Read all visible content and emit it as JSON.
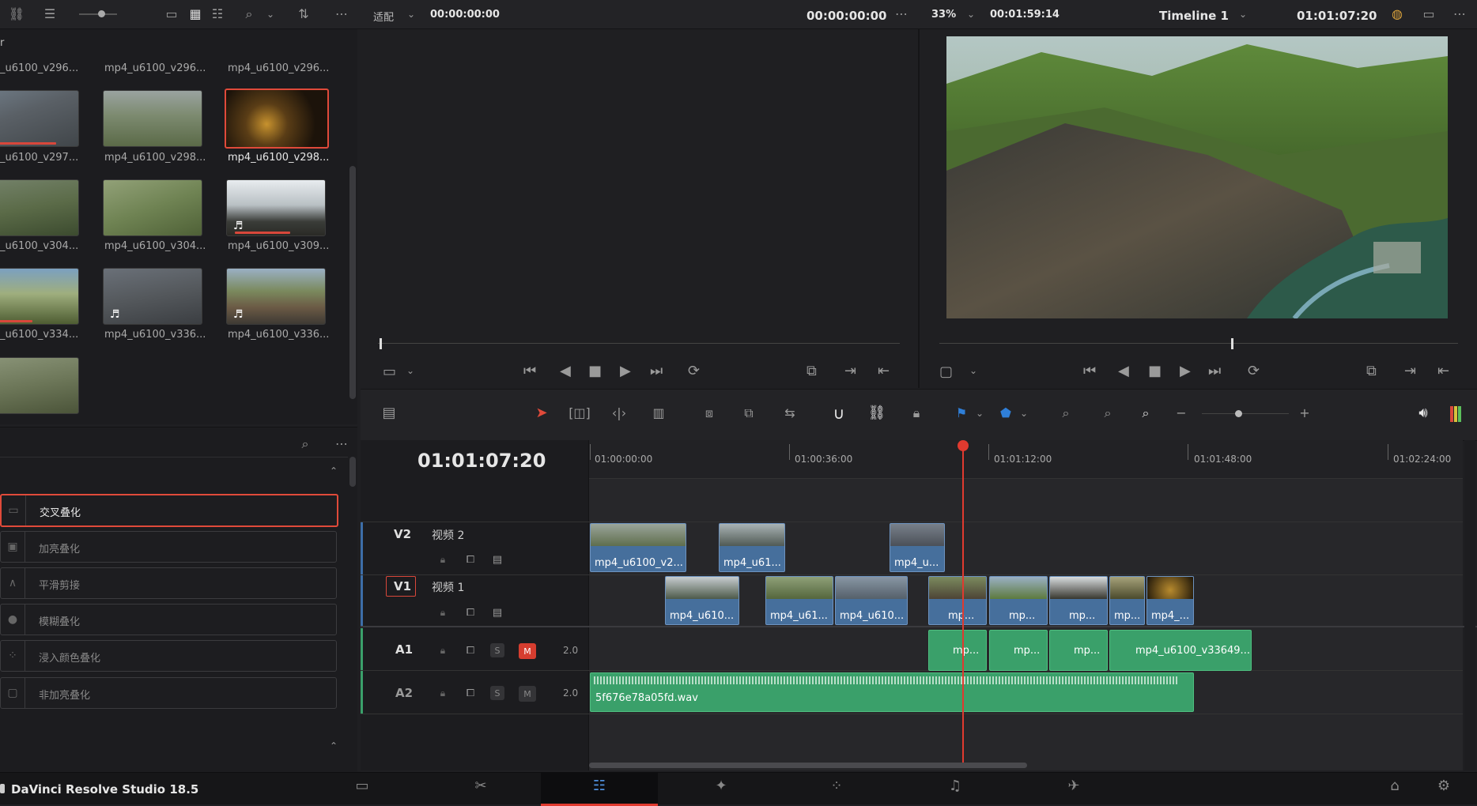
{
  "top_bar": {
    "fit_label": "适配",
    "source_timecode": "00:00:00:00",
    "source_duration": "00:00:00:00",
    "zoom": "33%",
    "timeline_duration": "00:01:59:14",
    "timeline_name": "Timeline 1",
    "timeline_timecode": "01:01:07:20"
  },
  "media_pool": {
    "header_truncated": "r",
    "top_row_labels": [
      "_u6100_v296...",
      "mp4_u6100_v296...",
      "mp4_u6100_v296..."
    ],
    "clips": [
      {
        "label": "_u6100_v297...",
        "audio": false,
        "selected": false,
        "redline": true
      },
      {
        "label": "mp4_u6100_v298...",
        "audio": false,
        "selected": false,
        "redline": false
      },
      {
        "label": "mp4_u6100_v298...",
        "audio": false,
        "selected": true,
        "redline": false
      },
      {
        "label": "_u6100_v304...",
        "audio": false,
        "selected": false,
        "redline": false
      },
      {
        "label": "mp4_u6100_v304...",
        "audio": false,
        "selected": false,
        "redline": false
      },
      {
        "label": "mp4_u6100_v309...",
        "audio": true,
        "selected": false,
        "redline": true
      },
      {
        "label": "_u6100_v334...",
        "audio": false,
        "selected": false,
        "redline": true
      },
      {
        "label": "mp4_u6100_v336...",
        "audio": true,
        "selected": false,
        "redline": false
      },
      {
        "label": "mp4_u6100_v336...",
        "audio": true,
        "selected": false,
        "redline": false
      }
    ]
  },
  "transitions": {
    "items": [
      "交叉叠化",
      "加亮叠化",
      "平滑剪接",
      "模糊叠化",
      "浸入颜色叠化",
      "非加亮叠化"
    ],
    "selected_index": 0
  },
  "timeline": {
    "current_timecode": "01:01:07:20",
    "ruler": [
      "01:00:00:00",
      "01:00:36:00",
      "01:01:12:00",
      "01:01:48:00",
      "01:02:24:00"
    ],
    "tracks": {
      "v2": {
        "id": "V2",
        "name": "视频 2"
      },
      "v1": {
        "id": "V1",
        "name": "视频 1"
      },
      "a1": {
        "id": "A1",
        "s": "S",
        "m": "M",
        "channels": "2.0"
      },
      "a2": {
        "id": "A2",
        "s": "S",
        "m": "M",
        "channels": "2.0"
      }
    },
    "v2_clips": [
      "mp4_u6100_v2...",
      "mp4_u61...",
      "mp4_u..."
    ],
    "v1_clips": [
      "mp4_u610...",
      "mp4_u61...",
      "mp4_u610...",
      "mp...",
      "mp...",
      "mp...",
      "mp...",
      "mp4_..."
    ],
    "a1_clips": [
      "mp...",
      "mp...",
      "mp...",
      "mp4_u6100_v33649..."
    ],
    "a2_clip": "5f676e78a05fd.wav"
  },
  "footer": {
    "app_name": "DaVinci Resolve Studio 18.5"
  },
  "colors": {
    "accent_red": "#e04a3a",
    "video_clip": "#466f9c",
    "audio_clip": "#3aa06a",
    "playhead": "#e03a2f"
  }
}
